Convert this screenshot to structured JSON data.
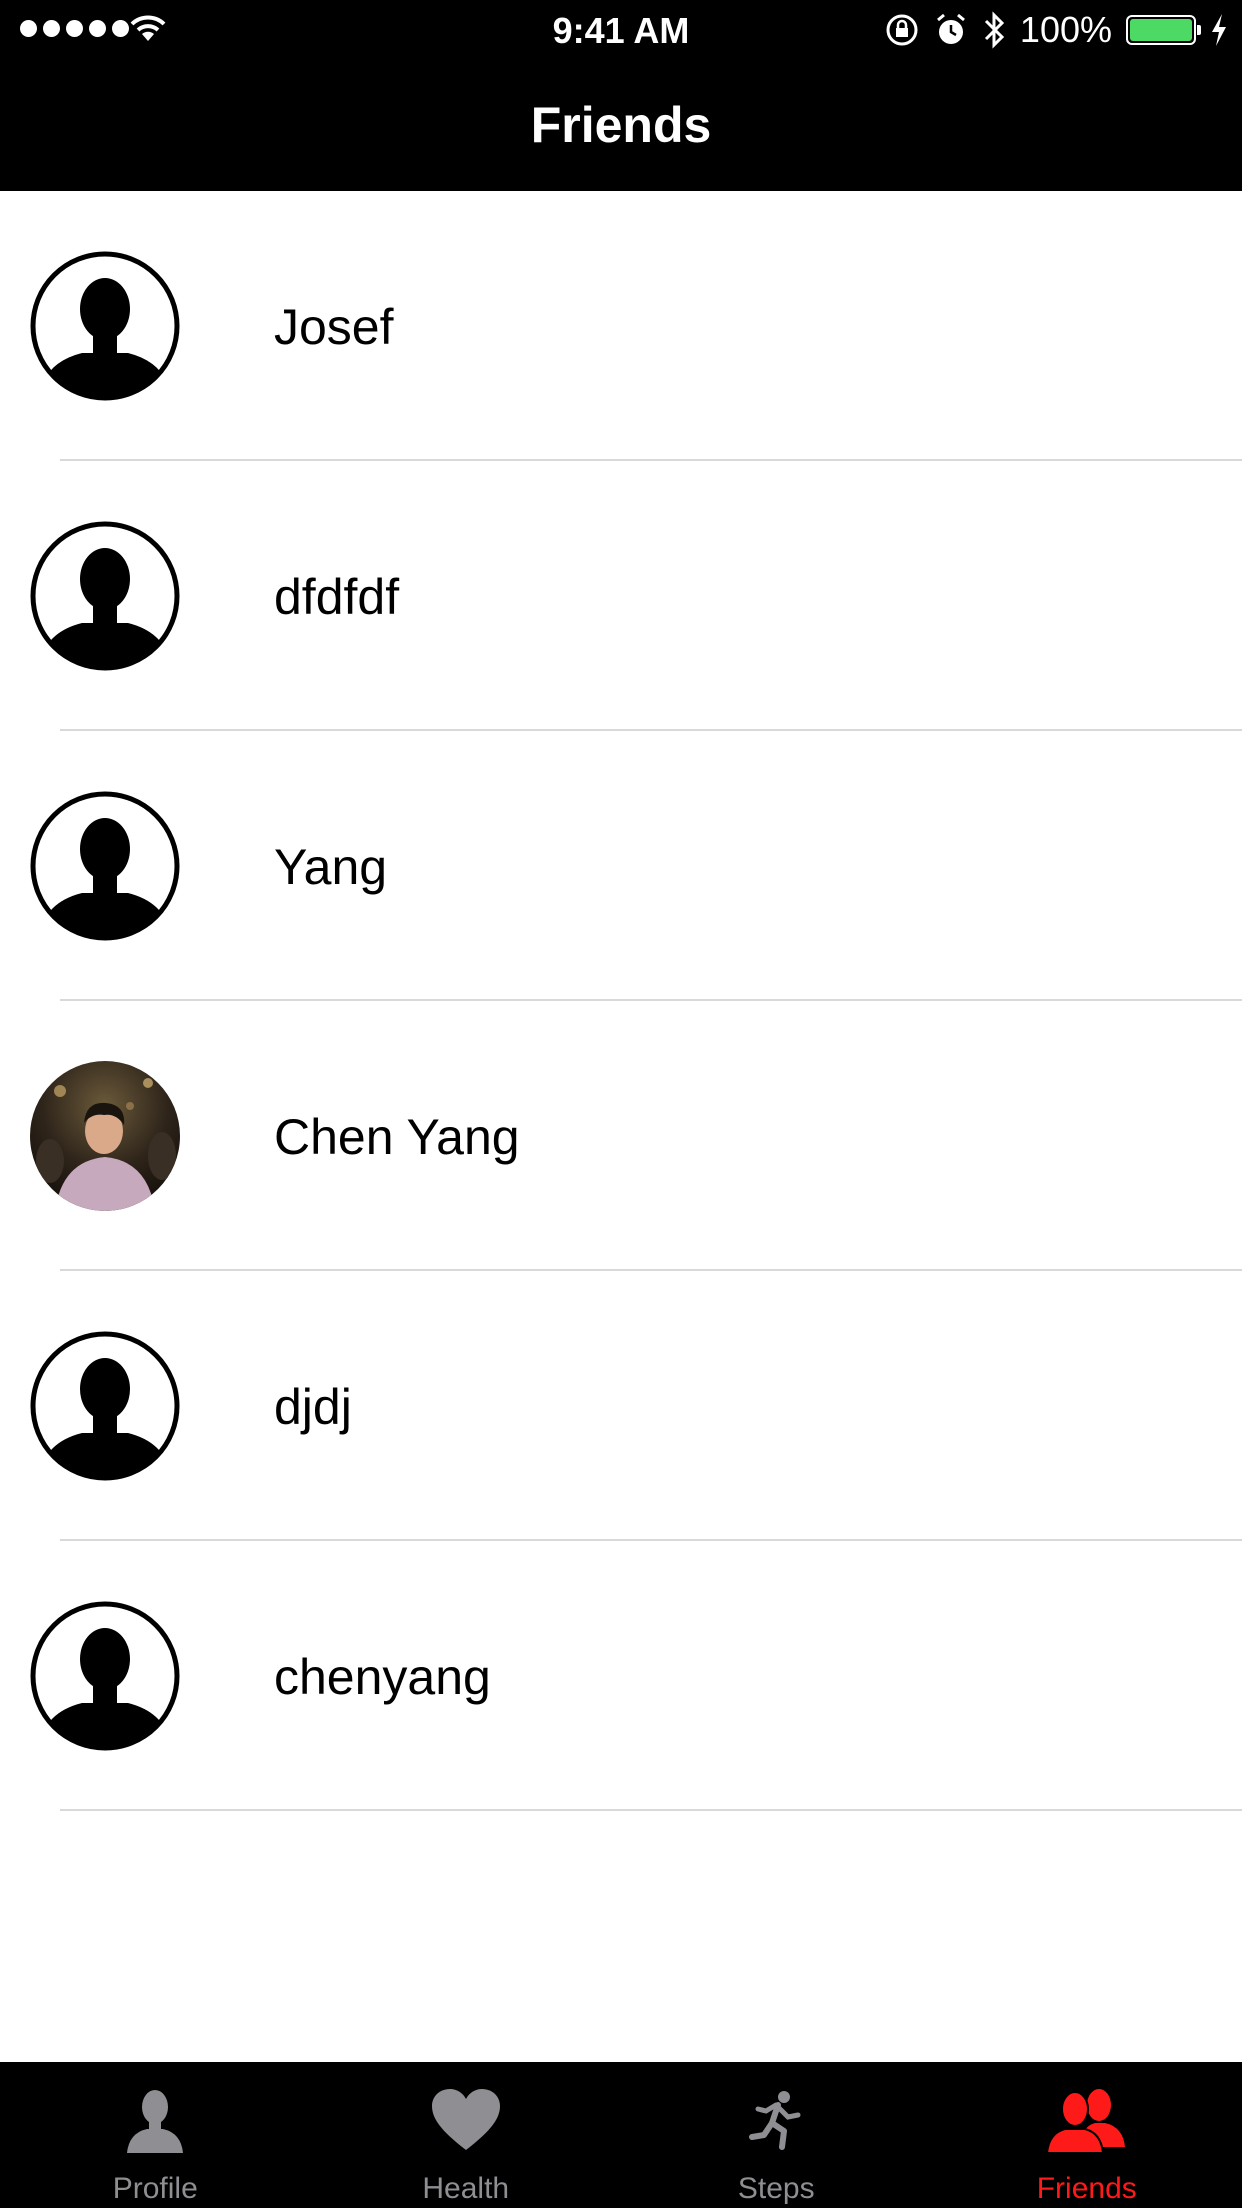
{
  "status_bar": {
    "time": "9:41 AM",
    "battery_percent": "100%",
    "signal_bars": 5,
    "battery_level": 1.0
  },
  "nav": {
    "title": "Friends"
  },
  "friends": [
    {
      "name": "Josef",
      "avatar": "default-avatar-icon"
    },
    {
      "name": "dfdfdf",
      "avatar": "default-avatar-icon"
    },
    {
      "name": "Yang",
      "avatar": "default-avatar-icon"
    },
    {
      "name": "Chen Yang",
      "avatar": "photo"
    },
    {
      "name": "djdj",
      "avatar": "default-avatar-icon"
    },
    {
      "name": "chenyang",
      "avatar": "default-avatar-icon"
    }
  ],
  "tabs": [
    {
      "label": "Profile",
      "icon": "person-icon",
      "active": false
    },
    {
      "label": "Health",
      "icon": "heart-icon",
      "active": false
    },
    {
      "label": "Steps",
      "icon": "running-icon",
      "active": false
    },
    {
      "label": "Friends",
      "icon": "people-icon",
      "active": true
    }
  ],
  "colors": {
    "accent": "#ff1a1a",
    "inactive_tab": "#8e8e93",
    "battery": "#4cd964"
  }
}
